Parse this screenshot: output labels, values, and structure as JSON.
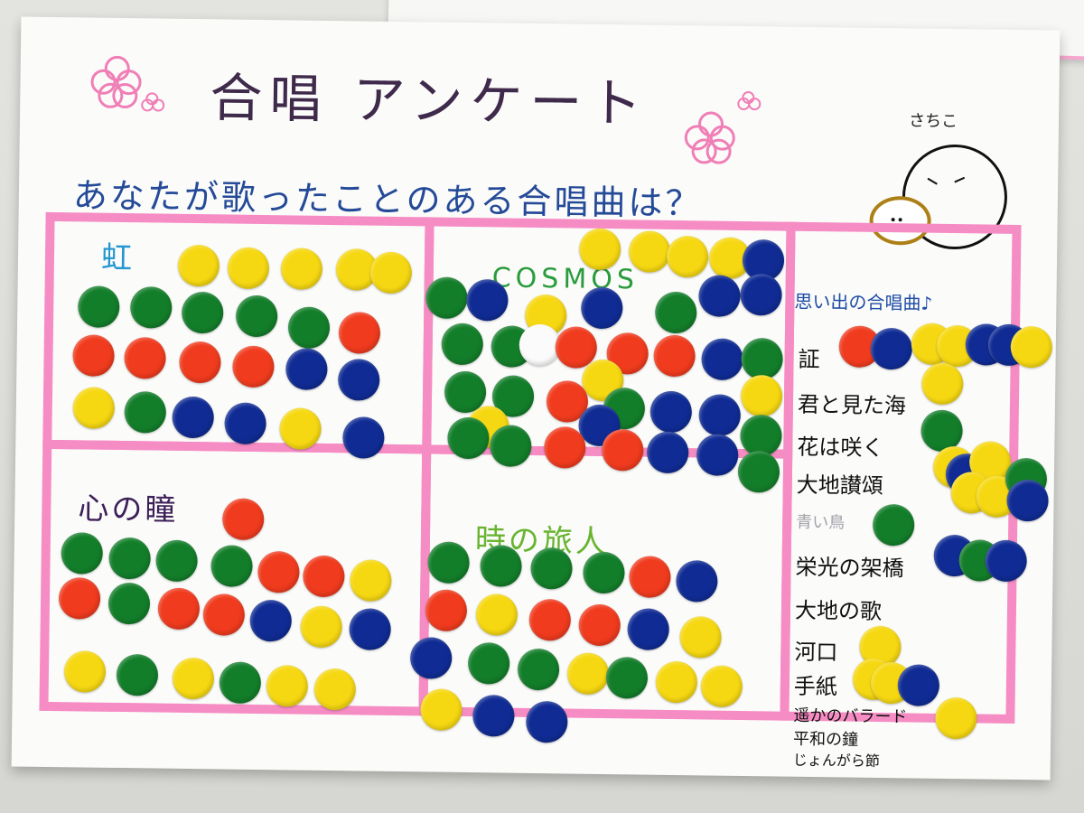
{
  "poster": {
    "title": "合唱 アンケート",
    "subtitle": "あなたが歌ったことのある合唱曲は？",
    "author": "さちこ",
    "quadrant_labels": {
      "niji": "虹",
      "cosmos": "COSMOS",
      "kokoro": "心の瞳",
      "tabibito": "時の旅人"
    },
    "sidebar": {
      "title": "思い出の合唱曲♪",
      "songs": [
        "証",
        "君と見た海",
        "花は咲く",
        "大地讃頌",
        "青い鳥",
        "栄光の架橋",
        "大地の歌",
        "河口",
        "手紙",
        "遥かのバラード",
        "平和の鐘",
        "じょんがら節"
      ]
    },
    "colors": {
      "pink": "#f68cc4",
      "green": "#137e2a",
      "red": "#f03b1e",
      "yellow": "#f6d812",
      "blue": "#102c94"
    }
  }
}
